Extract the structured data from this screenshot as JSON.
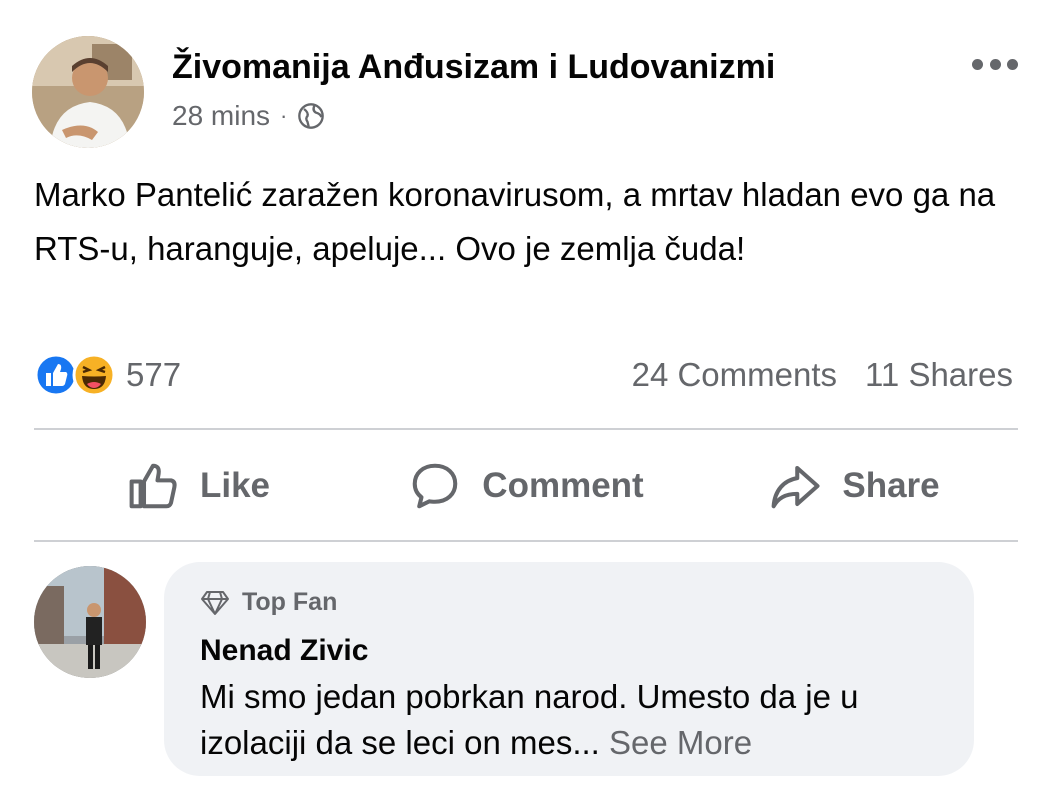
{
  "post": {
    "author": "Živomanija Anđusizam i Ludovanizmi",
    "time": "28 mins",
    "separator": "·",
    "privacy_icon": "globe-icon",
    "menu_icon": "more-options-icon",
    "text": "Marko Pantelić zaražen koronavirusom, a mrtav hladan evo ga na RTS-u, haranguje, apeluje... Ovo je zemlja čuda!",
    "reaction_icons": [
      "like-reaction-icon",
      "haha-reaction-icon"
    ],
    "reaction_count": "577",
    "comments_count": "24 Comments",
    "shares_count": "11 Shares"
  },
  "actions": {
    "like": "Like",
    "comment": "Comment",
    "share": "Share"
  },
  "comment": {
    "badge": "Top Fan",
    "badge_icon": "diamond-icon",
    "author": "Nenad Zivic",
    "text": "Mi smo jedan pobrkan narod. Umesto da je u izolaciji da se leci on mes...",
    "see_more": "See More"
  },
  "colors": {
    "text_primary": "#050505",
    "text_secondary": "#65676b",
    "divider": "#ced0d4",
    "bubble": "#f0f2f5",
    "like_blue": "#1877f2",
    "haha_yellow": "#f7b125"
  }
}
